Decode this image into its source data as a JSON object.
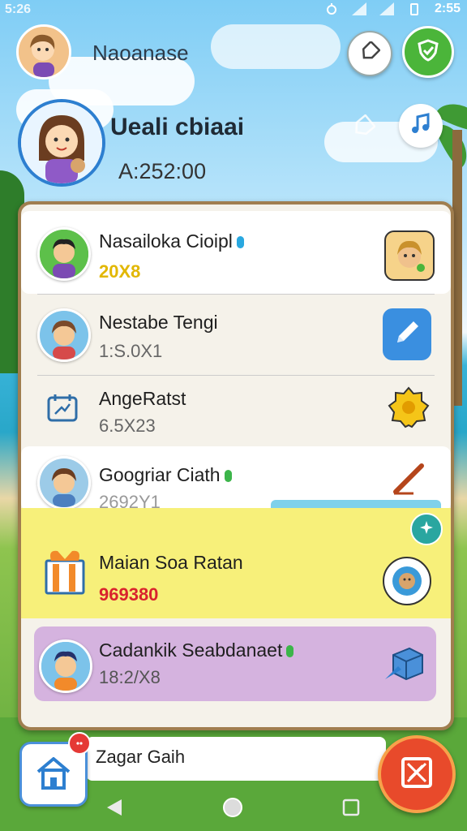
{
  "status_bar": {
    "time": "5:26",
    "right_text": "2:55"
  },
  "header": {
    "title": "Naoanase"
  },
  "profile": {
    "name": "Ueali cbiaai",
    "amount": "A:252:00"
  },
  "list": [
    {
      "name": "Nasailoka Cioipl",
      "amount": "20X8",
      "amount_color": "#e2b700",
      "dot_color": "#29a8e0"
    },
    {
      "name": "Nestabe Tengi",
      "amount": "1:S.0X1",
      "amount_color": "#666666"
    },
    {
      "name": "AngeRatst",
      "amount": "6.5X23",
      "amount_color": "#666666"
    },
    {
      "name": "Googriar Ciath",
      "amount": "2692Y1",
      "amount_color": "#888888",
      "dot_color": "#3cb54a"
    },
    {
      "name": "Maian Soa Ratan",
      "amount": "969380",
      "amount_color": "#d9232d"
    },
    {
      "name": "Cadankik Seabdanaet",
      "amount": "18:2/X8",
      "amount_color": "#555555",
      "dot_color": "#3cb54a"
    }
  ],
  "bottom": {
    "label": "Zagar Gaih"
  },
  "colors": {
    "accent_green": "#4bb53a",
    "accent_blue": "#2d7fd0",
    "highlight_yellow": "#f7f07a",
    "highlight_purple": "#d5b3df",
    "fab_red": "#e84a2b"
  },
  "icons": [
    "tag-icon",
    "shield-check-icon",
    "music-note-icon",
    "pen-icon",
    "star-badge-icon",
    "paintbrush-icon",
    "pin-icon",
    "cube-icon",
    "home-icon",
    "cancel-ticket-icon"
  ]
}
